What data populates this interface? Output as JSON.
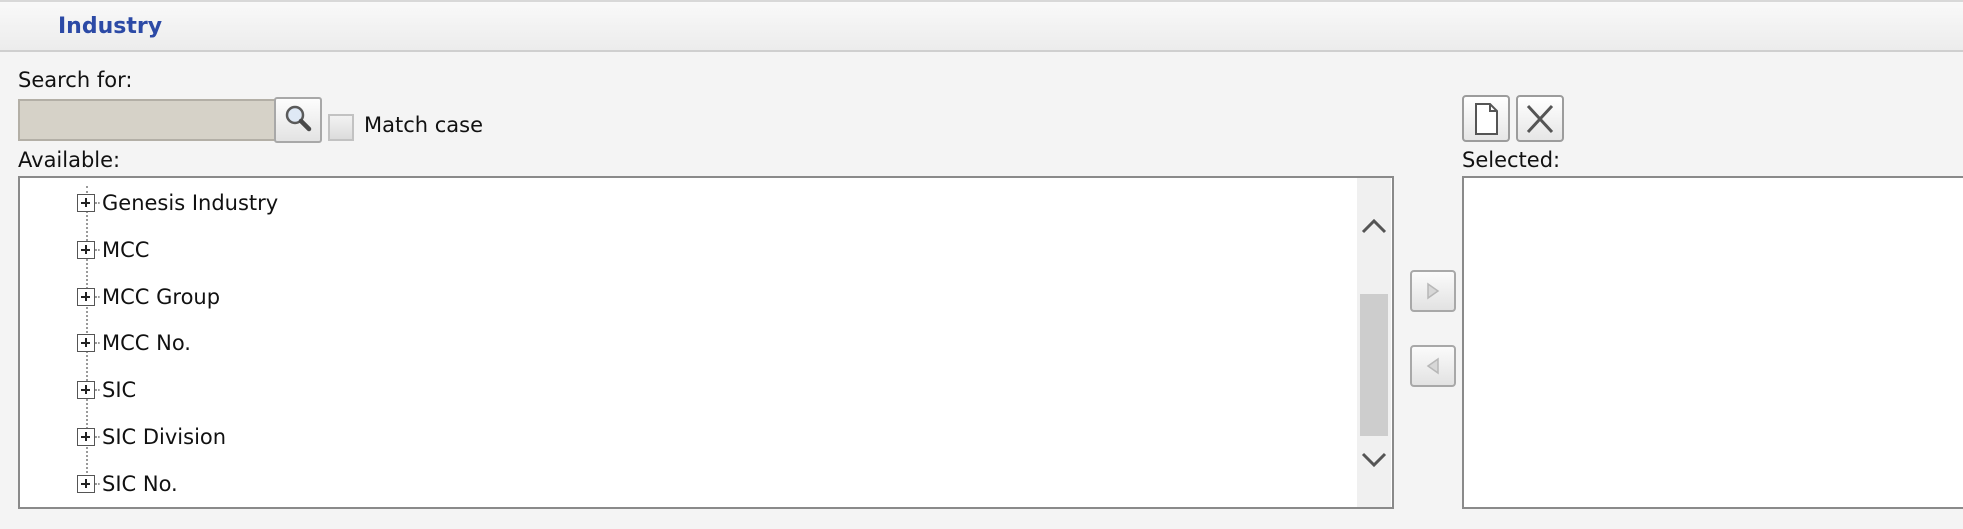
{
  "header": {
    "title": "Industry"
  },
  "search": {
    "label": "Search for:",
    "value": "",
    "placeholder": "",
    "button_icon": "magnifier-icon",
    "match_case_label": "Match case",
    "match_case_checked": false
  },
  "available": {
    "label": "Available:",
    "items": [
      {
        "label": "Genesis Industry",
        "expanded": false
      },
      {
        "label": "MCC",
        "expanded": false
      },
      {
        "label": "MCC Group",
        "expanded": false
      },
      {
        "label": "MCC No.",
        "expanded": false
      },
      {
        "label": "SIC",
        "expanded": false
      },
      {
        "label": "SIC Division",
        "expanded": false
      },
      {
        "label": "SIC No.",
        "expanded": false
      }
    ]
  },
  "selected": {
    "label": "Selected:",
    "items": []
  },
  "toolbar": {
    "new_icon": "new-document-icon",
    "clear_icon": "clear-x-icon"
  },
  "transfer": {
    "add_icon": "arrow-right-icon",
    "remove_icon": "arrow-left-icon"
  },
  "colors": {
    "header_title": "#2c4aa6",
    "search_field": "#d6d2c8"
  }
}
